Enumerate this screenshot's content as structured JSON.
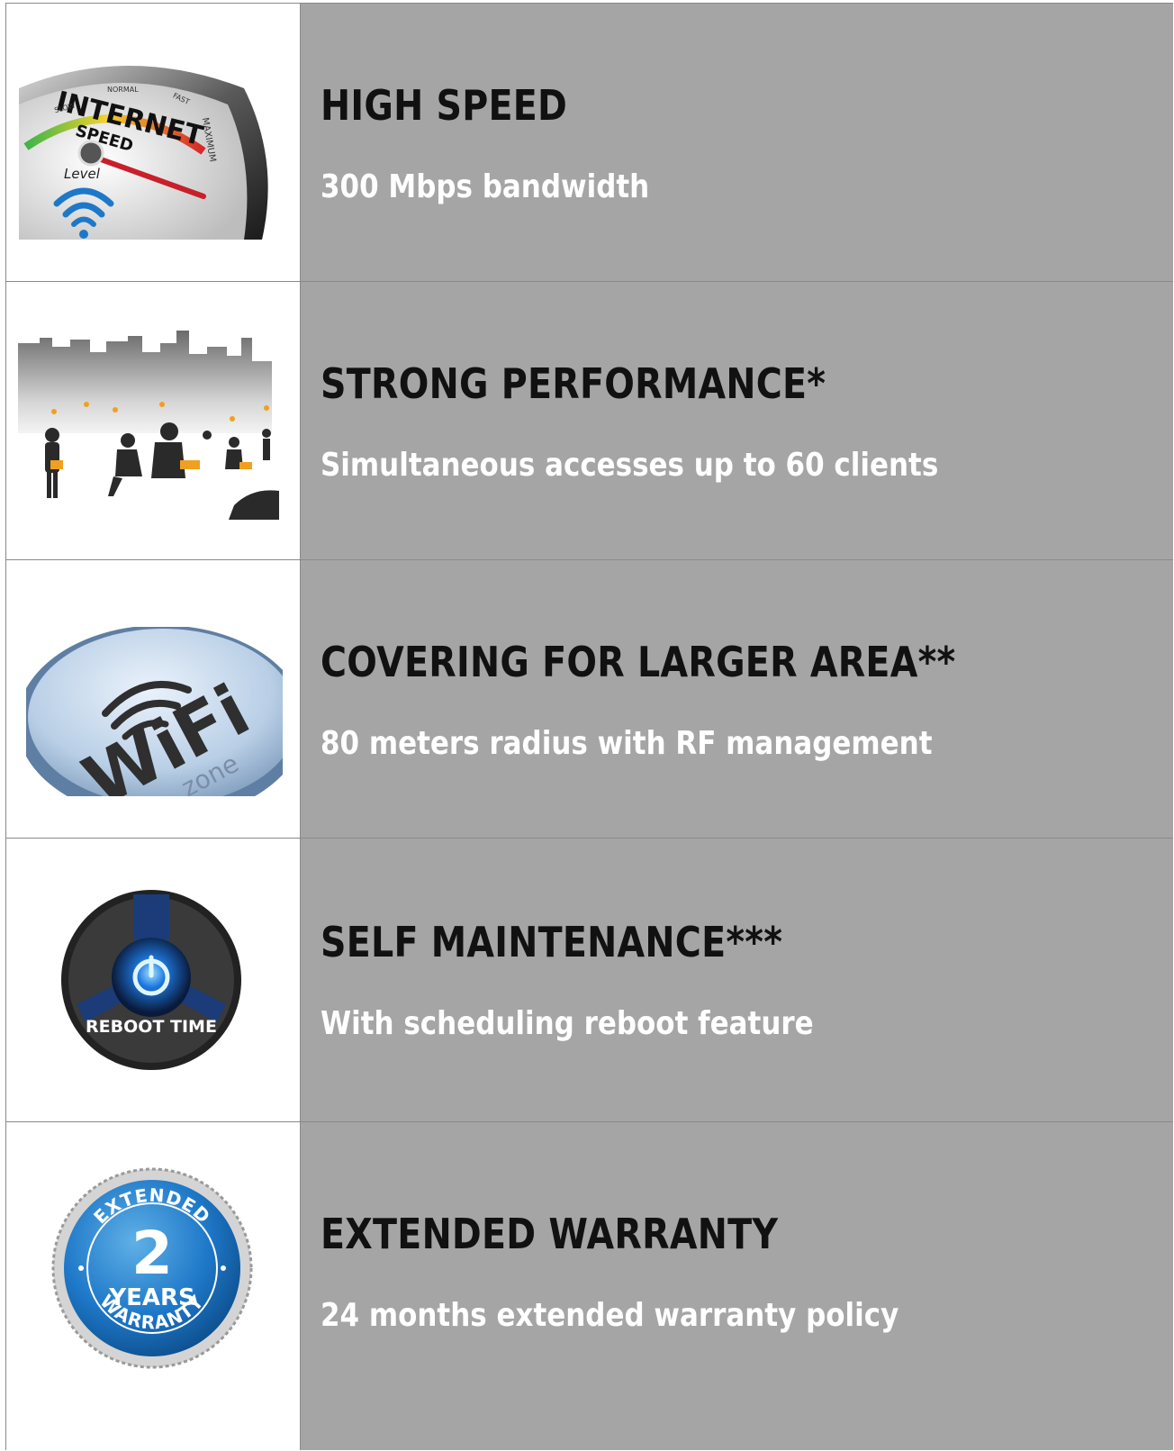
{
  "features": [
    {
      "title": "HIGH SPEED",
      "description": "300 Mbps bandwidth",
      "icon": "internet-speed-gauge",
      "gauge": {
        "brand": "INTERNET",
        "word": "SPEED",
        "level_label": "Level",
        "scale_labels": [
          "SLOW",
          "NORMAL",
          "FAST",
          "MAXIMUM"
        ],
        "needle_level": 0.9
      }
    },
    {
      "title": "STRONG PERFORMANCE*",
      "description": "Simultaneous accesses up to 60 clients",
      "icon": "connected-people-city"
    },
    {
      "title": "COVERING FOR LARGER AREA**",
      "description": "80 meters radius with RF management",
      "icon": "wifi-zone-button",
      "badge": {
        "wifi_text": "WiFi",
        "zone_text": "zone"
      }
    },
    {
      "title": "SELF MAINTENANCE***",
      "description": "With scheduling reboot feature",
      "icon": "reboot-time-button",
      "badge": {
        "label": "REBOOT TIME"
      }
    },
    {
      "title": "EXTENDED WARRANTY",
      "description": "24 months extended warranty policy",
      "icon": "warranty-seal",
      "badge": {
        "top": "EXTENDED",
        "number": "2",
        "unit": "YEARS",
        "bottom": "WARRANTY"
      }
    }
  ],
  "colors": {
    "text_cell_bg": "#a5a5a5",
    "title_text": "#111111",
    "description_text": "#ffffff",
    "border": "#8a8a8a",
    "accent_blue": "#1e78c8"
  }
}
